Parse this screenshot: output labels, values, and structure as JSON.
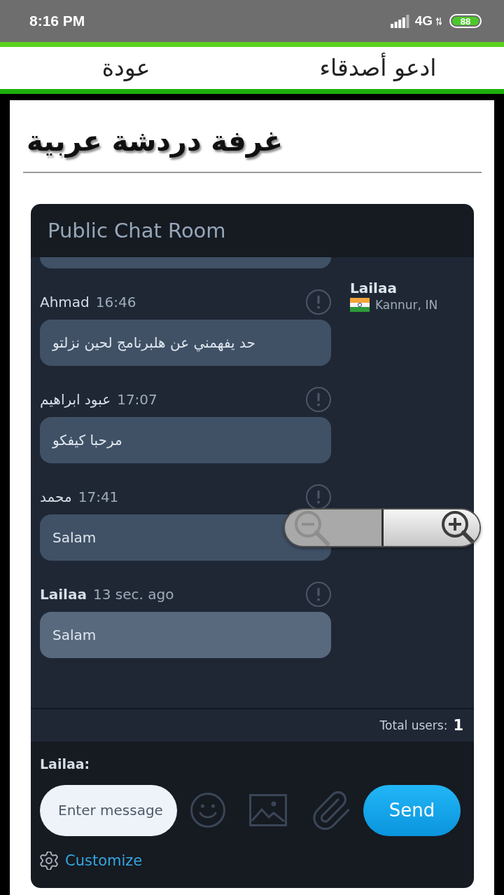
{
  "status_bar": {
    "time": "8:16 PM",
    "network": "4G",
    "battery": "88"
  },
  "nav": {
    "links": [
      {
        "label": "ادعو أصدقاء"
      },
      {
        "label": "عودة"
      }
    ]
  },
  "page": {
    "title": "غرفة دردشة عربية"
  },
  "chat": {
    "title": "Public Chat Room",
    "messages": [
      {
        "kind": "clipped"
      },
      {
        "kind": "message",
        "author": "Ahmad",
        "time": "16:46",
        "text": "حد يفهمني عن هلبرنامج لحين نزلتو",
        "own": false
      },
      {
        "kind": "message",
        "author": "عبود ابراهيم",
        "time": "17:07",
        "text": "مرحبا كيفكو",
        "own": false
      },
      {
        "kind": "message",
        "author": "محمد",
        "time": "17:41",
        "text": "Salam",
        "own": false
      },
      {
        "kind": "message",
        "author": "Lailaa",
        "time": "13 sec. ago",
        "text": "Salam",
        "own": true
      }
    ],
    "users": [
      {
        "name": "Lailaa",
        "location": "Kannur, IN"
      }
    ],
    "total_users": {
      "label": "Total users:",
      "count": "1"
    },
    "composer": {
      "user_label": "Lailaa:",
      "placeholder": "Enter message",
      "send_label": "Send",
      "customize_label": "Customize"
    }
  },
  "zoom_control": {
    "buttons": [
      {
        "kind": "zoom_out",
        "disabled": true
      },
      {
        "kind": "zoom_in",
        "disabled": false
      }
    ]
  }
}
